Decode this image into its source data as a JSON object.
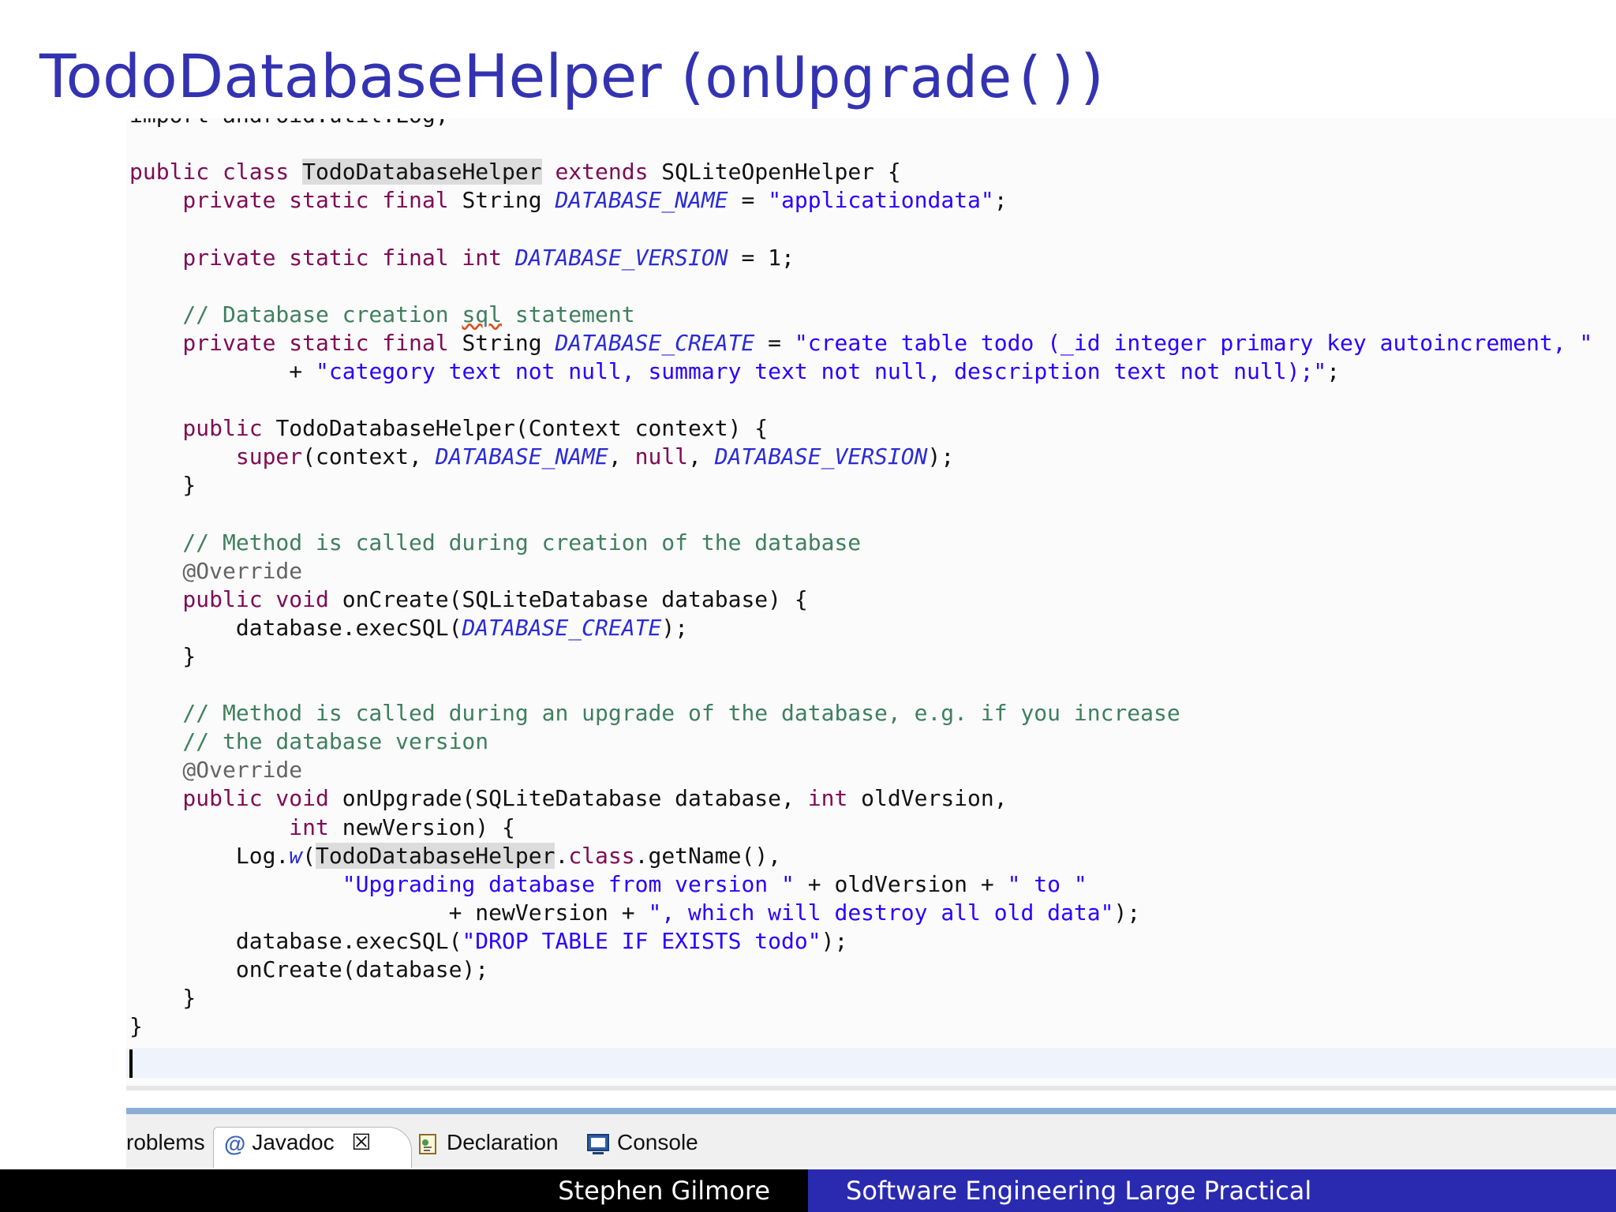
{
  "slide": {
    "title_main": "TodoDatabaseHelper (",
    "title_mono": "onUpgrade()",
    "title_close": ")"
  },
  "code": {
    "lines": [
      [
        {
          "t": "import android.util.Log;",
          "c": ""
        }
      ],
      [],
      [
        {
          "t": "public class ",
          "c": "kw"
        },
        {
          "t": "TodoDatabaseHelper",
          "c": "hl"
        },
        {
          "t": " extends",
          "c": "kw"
        },
        {
          "t": " SQLiteOpenHelper {",
          "c": ""
        }
      ],
      [
        {
          "t": "    private static final ",
          "c": "kw"
        },
        {
          "t": "String ",
          "c": ""
        },
        {
          "t": "DATABASE_NAME",
          "c": "const"
        },
        {
          "t": " = ",
          "c": ""
        },
        {
          "t": "\"applicationdata\"",
          "c": "str"
        },
        {
          "t": ";",
          "c": ""
        }
      ],
      [],
      [
        {
          "t": "    private static final int ",
          "c": "kw"
        },
        {
          "t": "DATABASE_VERSION",
          "c": "const"
        },
        {
          "t": " = 1;",
          "c": ""
        }
      ],
      [],
      [
        {
          "t": "    // Database creation ",
          "c": "cmt"
        },
        {
          "t": "sql",
          "c": "cmt squig"
        },
        {
          "t": " statement",
          "c": "cmt"
        }
      ],
      [
        {
          "t": "    private static final ",
          "c": "kw"
        },
        {
          "t": "String ",
          "c": ""
        },
        {
          "t": "DATABASE_CREATE",
          "c": "const"
        },
        {
          "t": " = ",
          "c": ""
        },
        {
          "t": "\"create table todo (_id integer primary key autoincrement, \"",
          "c": "str"
        }
      ],
      [
        {
          "t": "            + ",
          "c": ""
        },
        {
          "t": "\"category text not null, summary text not null, description text not null);\"",
          "c": "str"
        },
        {
          "t": ";",
          "c": ""
        }
      ],
      [],
      [
        {
          "t": "    public ",
          "c": "kw"
        },
        {
          "t": "TodoDatabaseHelper(Context context) {",
          "c": ""
        }
      ],
      [
        {
          "t": "        super",
          "c": "kw"
        },
        {
          "t": "(context, ",
          "c": ""
        },
        {
          "t": "DATABASE_NAME",
          "c": "const"
        },
        {
          "t": ", ",
          "c": ""
        },
        {
          "t": "null",
          "c": "kw"
        },
        {
          "t": ", ",
          "c": ""
        },
        {
          "t": "DATABASE_VERSION",
          "c": "const"
        },
        {
          "t": ");",
          "c": ""
        }
      ],
      [
        {
          "t": "    }",
          "c": ""
        }
      ],
      [],
      [
        {
          "t": "    // Method is called during creation of the database",
          "c": "cmt"
        }
      ],
      [
        {
          "t": "    @Override",
          "c": "ann"
        }
      ],
      [
        {
          "t": "    public void ",
          "c": "kw"
        },
        {
          "t": "onCreate(SQLiteDatabase database) {",
          "c": ""
        }
      ],
      [
        {
          "t": "        database.execSQL(",
          "c": ""
        },
        {
          "t": "DATABASE_CREATE",
          "c": "const"
        },
        {
          "t": ");",
          "c": ""
        }
      ],
      [
        {
          "t": "    }",
          "c": ""
        }
      ],
      [],
      [
        {
          "t": "    // Method is called during an upgrade of the database, e.g. if you increase",
          "c": "cmt"
        }
      ],
      [
        {
          "t": "    // the database version",
          "c": "cmt"
        }
      ],
      [
        {
          "t": "    @Override",
          "c": "ann"
        }
      ],
      [
        {
          "t": "    public void ",
          "c": "kw"
        },
        {
          "t": "onUpgrade(SQLiteDatabase database, ",
          "c": ""
        },
        {
          "t": "int",
          "c": "kw"
        },
        {
          "t": " oldVersion,",
          "c": ""
        }
      ],
      [
        {
          "t": "            int",
          "c": "kw"
        },
        {
          "t": " newVersion) {",
          "c": ""
        }
      ],
      [
        {
          "t": "        Log.",
          "c": ""
        },
        {
          "t": "w",
          "c": "const"
        },
        {
          "t": "(",
          "c": ""
        },
        {
          "t": "TodoDatabaseHelper",
          "c": "hl"
        },
        {
          "t": ".",
          "c": ""
        },
        {
          "t": "class",
          "c": "kw"
        },
        {
          "t": ".getName(),",
          "c": ""
        }
      ],
      [
        {
          "t": "                ",
          "c": ""
        },
        {
          "t": "\"Upgrading database from version \"",
          "c": "str"
        },
        {
          "t": " + oldVersion + ",
          "c": ""
        },
        {
          "t": "\" to \"",
          "c": "str"
        }
      ],
      [
        {
          "t": "                        + newVersion + ",
          "c": ""
        },
        {
          "t": "\", which will destroy all old data\"",
          "c": "str"
        },
        {
          "t": ");",
          "c": ""
        }
      ],
      [
        {
          "t": "        database.execSQL(",
          "c": ""
        },
        {
          "t": "\"DROP TABLE IF EXISTS todo\"",
          "c": "str"
        },
        {
          "t": ");",
          "c": ""
        }
      ],
      [
        {
          "t": "        onCreate(database);",
          "c": ""
        }
      ],
      [
        {
          "t": "    }",
          "c": ""
        }
      ],
      [
        {
          "t": "}",
          "c": ""
        }
      ]
    ]
  },
  "panel": {
    "tabs": [
      {
        "label": "roblems"
      },
      {
        "label": "Javadoc",
        "close": "☒"
      },
      {
        "label": "Declaration"
      },
      {
        "label": "Console"
      }
    ]
  },
  "footer": {
    "author": "Stephen Gilmore",
    "course": "Software Engineering Large Practical"
  },
  "colors": {
    "title": "#3333b2",
    "keyword": "#7f0b55",
    "constant": "#2b2bd6",
    "string": "#2a00ff",
    "comment": "#3f7f5f",
    "footer_right_bg": "#2a2ab0"
  }
}
